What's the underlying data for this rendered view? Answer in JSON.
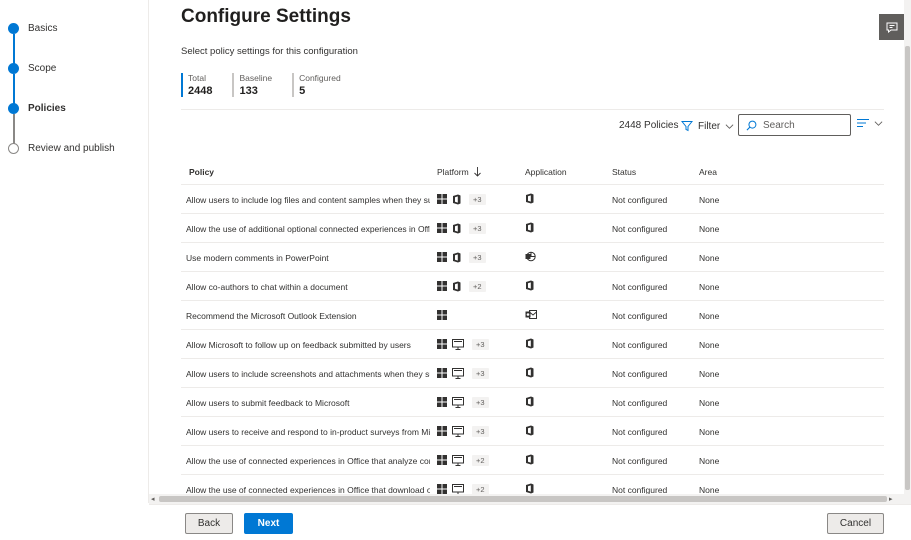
{
  "steps": [
    {
      "label": "Basics",
      "state": "complete"
    },
    {
      "label": "Scope",
      "state": "complete"
    },
    {
      "label": "Policies",
      "state": "current"
    },
    {
      "label": "Review and publish",
      "state": "pending"
    }
  ],
  "page": {
    "title": "Configure Settings",
    "subtitle": "Select policy settings for this configuration"
  },
  "stats": [
    {
      "label": "Total",
      "value": "2448"
    },
    {
      "label": "Baseline",
      "value": "133"
    },
    {
      "label": "Configured",
      "value": "5"
    }
  ],
  "toolbar": {
    "count": "2448 Policies",
    "filter_label": "Filter",
    "search_placeholder": "Search"
  },
  "table": {
    "columns": {
      "policy": "Policy",
      "platform": "Platform",
      "application": "Application",
      "status": "Status",
      "area": "Area"
    },
    "rows": [
      {
        "policy": "Allow users to include log files and content samples when they submit feedback to Microsoft",
        "platforms": [
          "windows-icon",
          "office-icon"
        ],
        "extra": "+3",
        "app": "office-icon",
        "status": "Not configured",
        "area": "None"
      },
      {
        "policy": "Allow the use of additional optional connected experiences in Office",
        "platforms": [
          "windows-icon",
          "office-icon"
        ],
        "extra": "+3",
        "app": "office-icon",
        "status": "Not configured",
        "area": "None"
      },
      {
        "policy": "Use modern comments in PowerPoint",
        "platforms": [
          "windows-icon",
          "office-icon"
        ],
        "extra": "+3",
        "app": "powerpoint-icon",
        "status": "Not configured",
        "area": "None"
      },
      {
        "policy": "Allow co-authors to chat within a document",
        "platforms": [
          "windows-icon",
          "office-icon"
        ],
        "extra": "+2",
        "app": "office-icon",
        "status": "Not configured",
        "area": "None"
      },
      {
        "policy": "Recommend the Microsoft Outlook Extension",
        "platforms": [
          "windows-icon"
        ],
        "extra": "",
        "app": "outlook-icon",
        "status": "Not configured",
        "area": "None"
      },
      {
        "policy": "Allow Microsoft to follow up on feedback submitted by users",
        "platforms": [
          "windows-icon",
          "desktop-icon"
        ],
        "extra": "+3",
        "app": "office-icon",
        "status": "Not configured",
        "area": "None"
      },
      {
        "policy": "Allow users to include screenshots and attachments when they submit feedback to Microsoft",
        "platforms": [
          "windows-icon",
          "desktop-icon"
        ],
        "extra": "+3",
        "app": "office-icon",
        "status": "Not configured",
        "area": "None"
      },
      {
        "policy": "Allow users to submit feedback to Microsoft",
        "platforms": [
          "windows-icon",
          "desktop-icon"
        ],
        "extra": "+3",
        "app": "office-icon",
        "status": "Not configured",
        "area": "None"
      },
      {
        "policy": "Allow users to receive and respond to in-product surveys from Microsoft",
        "platforms": [
          "windows-icon",
          "desktop-icon"
        ],
        "extra": "+3",
        "app": "office-icon",
        "status": "Not configured",
        "area": "None"
      },
      {
        "policy": "Allow the use of connected experiences in Office that analyze content",
        "platforms": [
          "windows-icon",
          "desktop-icon"
        ],
        "extra": "+2",
        "app": "office-icon",
        "status": "Not configured",
        "area": "None"
      },
      {
        "policy": "Allow the use of connected experiences in Office that download online content",
        "platforms": [
          "windows-icon",
          "desktop-icon"
        ],
        "extra": "+2",
        "app": "office-icon",
        "status": "Not configured",
        "area": "None"
      }
    ]
  },
  "footer": {
    "back_label": "Back",
    "next_label": "Next",
    "cancel_label": "Cancel"
  },
  "colors": {
    "accent": "#0078d4",
    "text": "#323130",
    "border": "#edebe9"
  }
}
